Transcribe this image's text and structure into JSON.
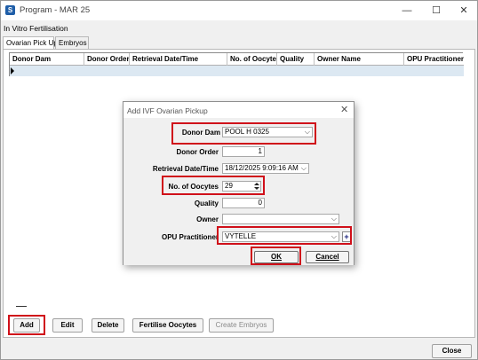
{
  "window": {
    "title": "Program - MAR 25",
    "app_icon_letter": "S",
    "minimize_glyph": "—",
    "maximize_glyph": "☐",
    "close_glyph": "✕"
  },
  "section_label": "In Vitro Fertilisation",
  "tabs": [
    {
      "label": "Ovarian Pick Up",
      "active": true
    },
    {
      "label": "Embryos",
      "active": false
    }
  ],
  "grid": {
    "columns": [
      "Donor Dam",
      "Donor Order",
      "Retrieval Date/Time",
      "No. of Oocytes",
      "Quality",
      "Owner Name",
      "OPU Practitioner"
    ]
  },
  "bottom_buttons": {
    "add": "Add",
    "edit": "Edit",
    "delete": "Delete",
    "fertilise": "Fertilise Oocytes",
    "create_embryos": "Create Embryos"
  },
  "close_button": "Close",
  "dialog": {
    "title": "Add IVF Ovarian Pickup",
    "close_glyph": "✕",
    "fields": {
      "donor_dam": {
        "label": "Donor Dam",
        "value": "POOL H 0325"
      },
      "donor_order": {
        "label": "Donor Order",
        "value": "1"
      },
      "retrieval": {
        "label": "Retrieval Date/Time",
        "value": "18/12/2025 9:09:16 AM"
      },
      "oocytes": {
        "label": "No. of Oocytes",
        "value": "29"
      },
      "quality": {
        "label": "Quality",
        "value": "0"
      },
      "owner": {
        "label": "Owner",
        "value": ""
      },
      "practitioner": {
        "label": "OPU Practitioner",
        "value": "VYTELLE"
      }
    },
    "chevron_glyph": "⌵",
    "plus_glyph": "+",
    "ok_label": "OK",
    "cancel_label": "Cancel"
  },
  "colors": {
    "highlight": "#d0101a",
    "selected_row": "#dce8f2"
  }
}
